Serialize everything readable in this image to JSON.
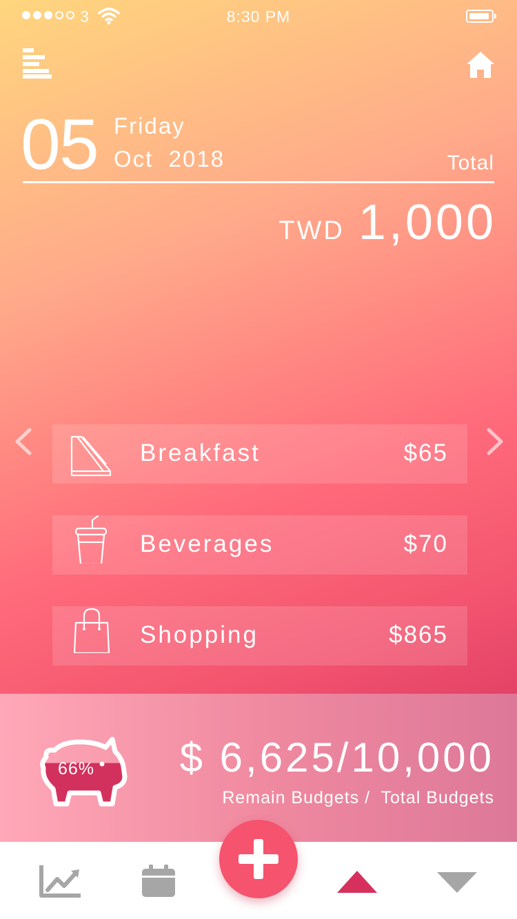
{
  "status_bar": {
    "carrier": "3",
    "time": "8:30 PM",
    "signal_icon": "signal-dots-icon",
    "wifi_icon": "wifi-icon",
    "battery_icon": "battery-icon"
  },
  "header": {
    "menu_icon": "menu-icon",
    "home_icon": "home-icon"
  },
  "date": {
    "day": "05",
    "weekday": "Friday",
    "month_year": "Oct  2018"
  },
  "total": {
    "label": "Total",
    "currency": "TWD",
    "amount": "1,000"
  },
  "categories": [
    {
      "label": "Breakfast",
      "value": "$65",
      "icon": "sandwich-icon"
    },
    {
      "label": "Beverages",
      "value": "$70",
      "icon": "drink-cup-icon"
    },
    {
      "label": "Shopping",
      "value": "$865",
      "icon": "shopping-bag-icon"
    }
  ],
  "budget": {
    "percent": "66%",
    "percent_value": 0.66,
    "amount": "$ 6,625/10,000",
    "caption": "Remain Budgets /  Total Budgets"
  },
  "tabbar": {
    "items": [
      "chart-icon",
      "calendar-icon",
      "add-icon",
      "arrow-up-icon",
      "arrow-down-icon"
    ]
  },
  "colors": {
    "accent": "#f5536e",
    "active_tab": "#d6315c",
    "inactive_tab": "#a6a6a6",
    "gradient_top": "#ffd67e",
    "gradient_bottom": "#cf2b5a"
  }
}
